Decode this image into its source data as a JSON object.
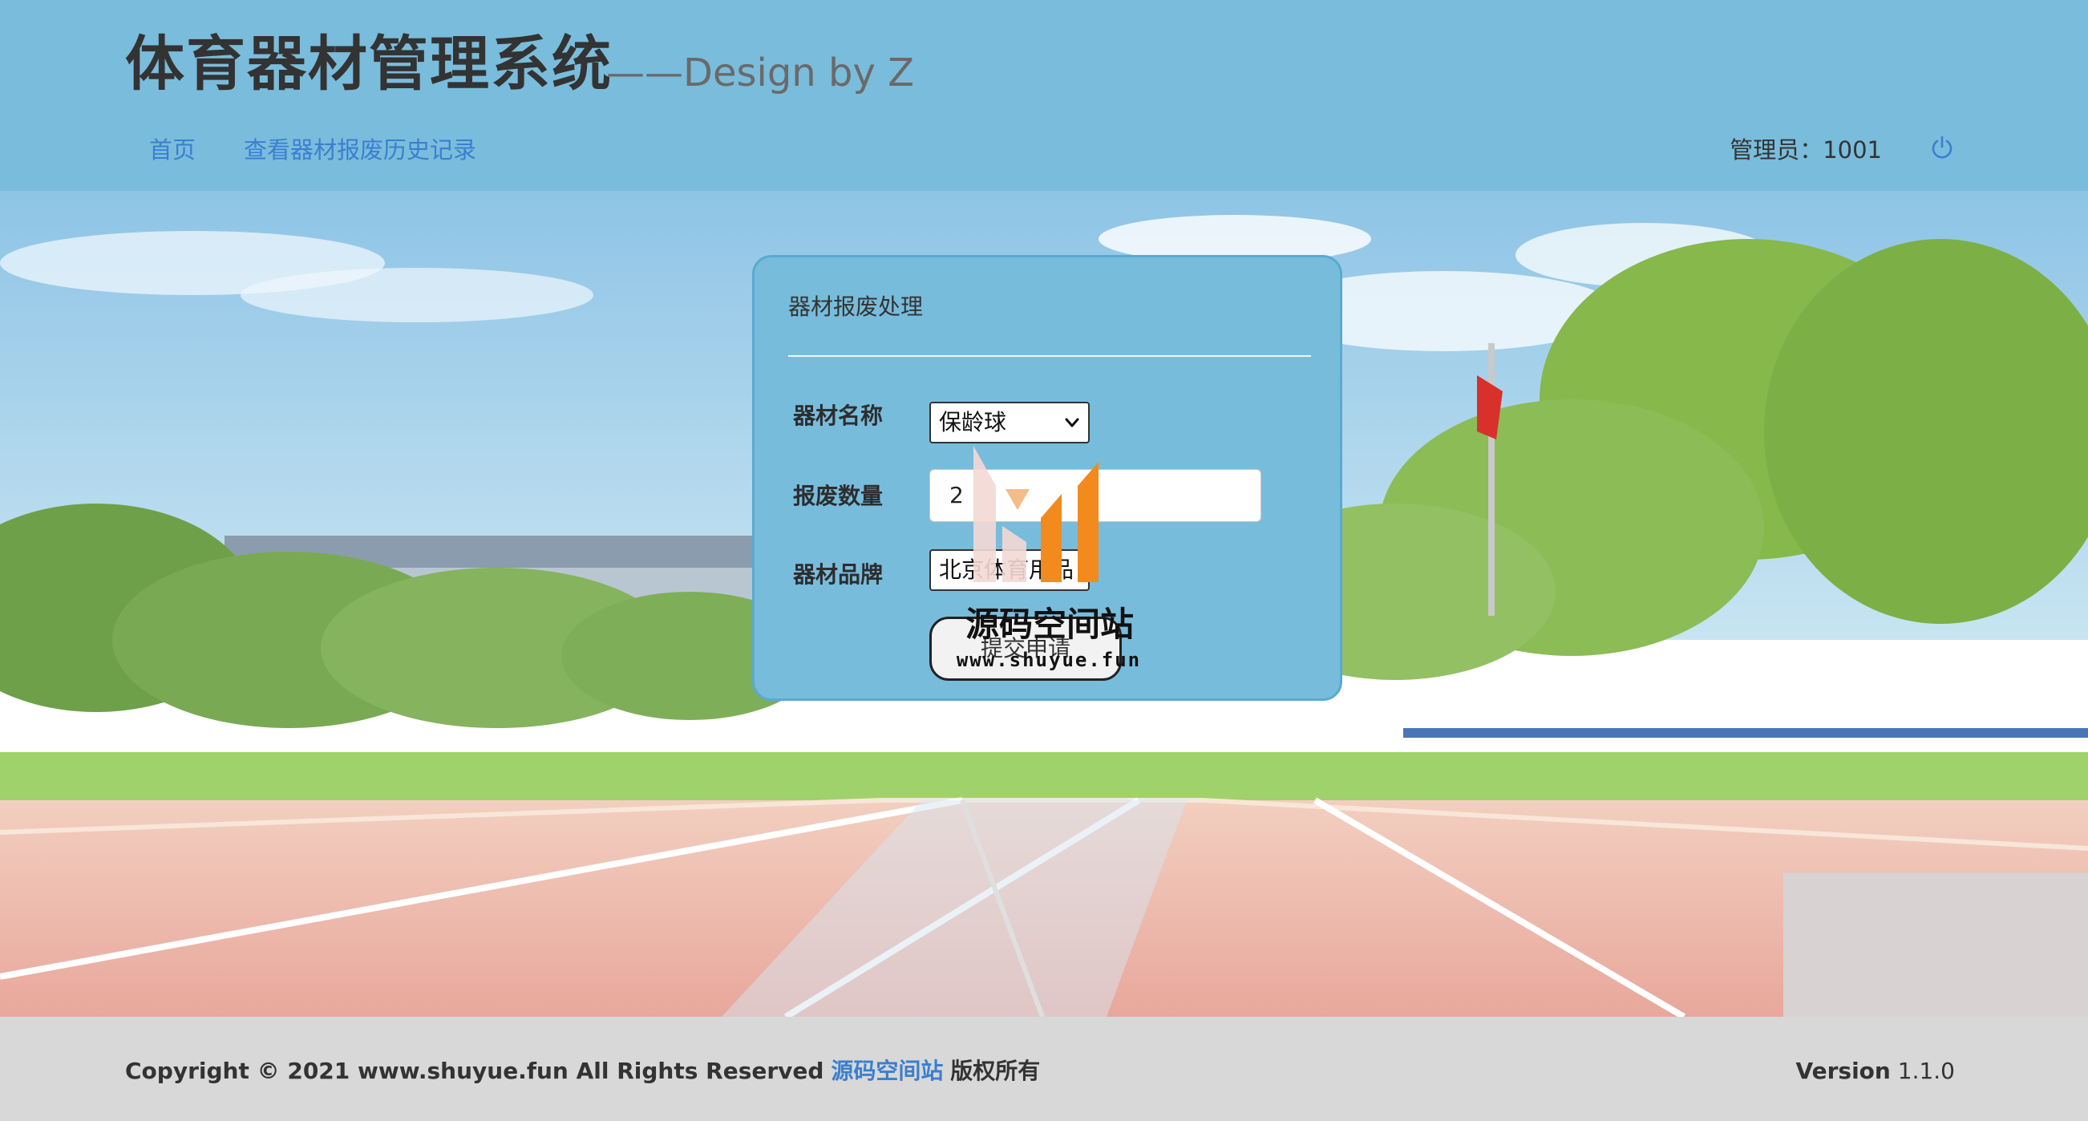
{
  "header": {
    "title": "体育器材管理系统",
    "subtitle": "——Design by Z",
    "nav": [
      {
        "label": "首页"
      },
      {
        "label": "查看器材报废历史记录"
      }
    ],
    "admin_label": "管理员：1001",
    "logout_icon": "power-icon"
  },
  "form": {
    "title": "器材报废处理",
    "name_label": "器材名称",
    "name_value": "保龄球",
    "quantity_label": "报废数量",
    "quantity_value": "2",
    "brand_label": "器材品牌",
    "brand_value": "北京体育用品",
    "submit_label": "提交申请"
  },
  "watermark": {
    "text": "源码空间站",
    "url": "www.shuyue.fun"
  },
  "footer": {
    "copyright": "Copyright © 2021 www.shuyue.fun All Rights Reserved",
    "link_text": "源码空间站",
    "rights_text": "版权所有",
    "version_label": "Version",
    "version_value": "1.1.0"
  },
  "colors": {
    "header_bg": "#7abcdb",
    "link": "#3a7fd0",
    "panel_bg": "#78bcdc",
    "footer_bg": "#d8d8d8",
    "watermark_orange": "#f28a1e"
  }
}
